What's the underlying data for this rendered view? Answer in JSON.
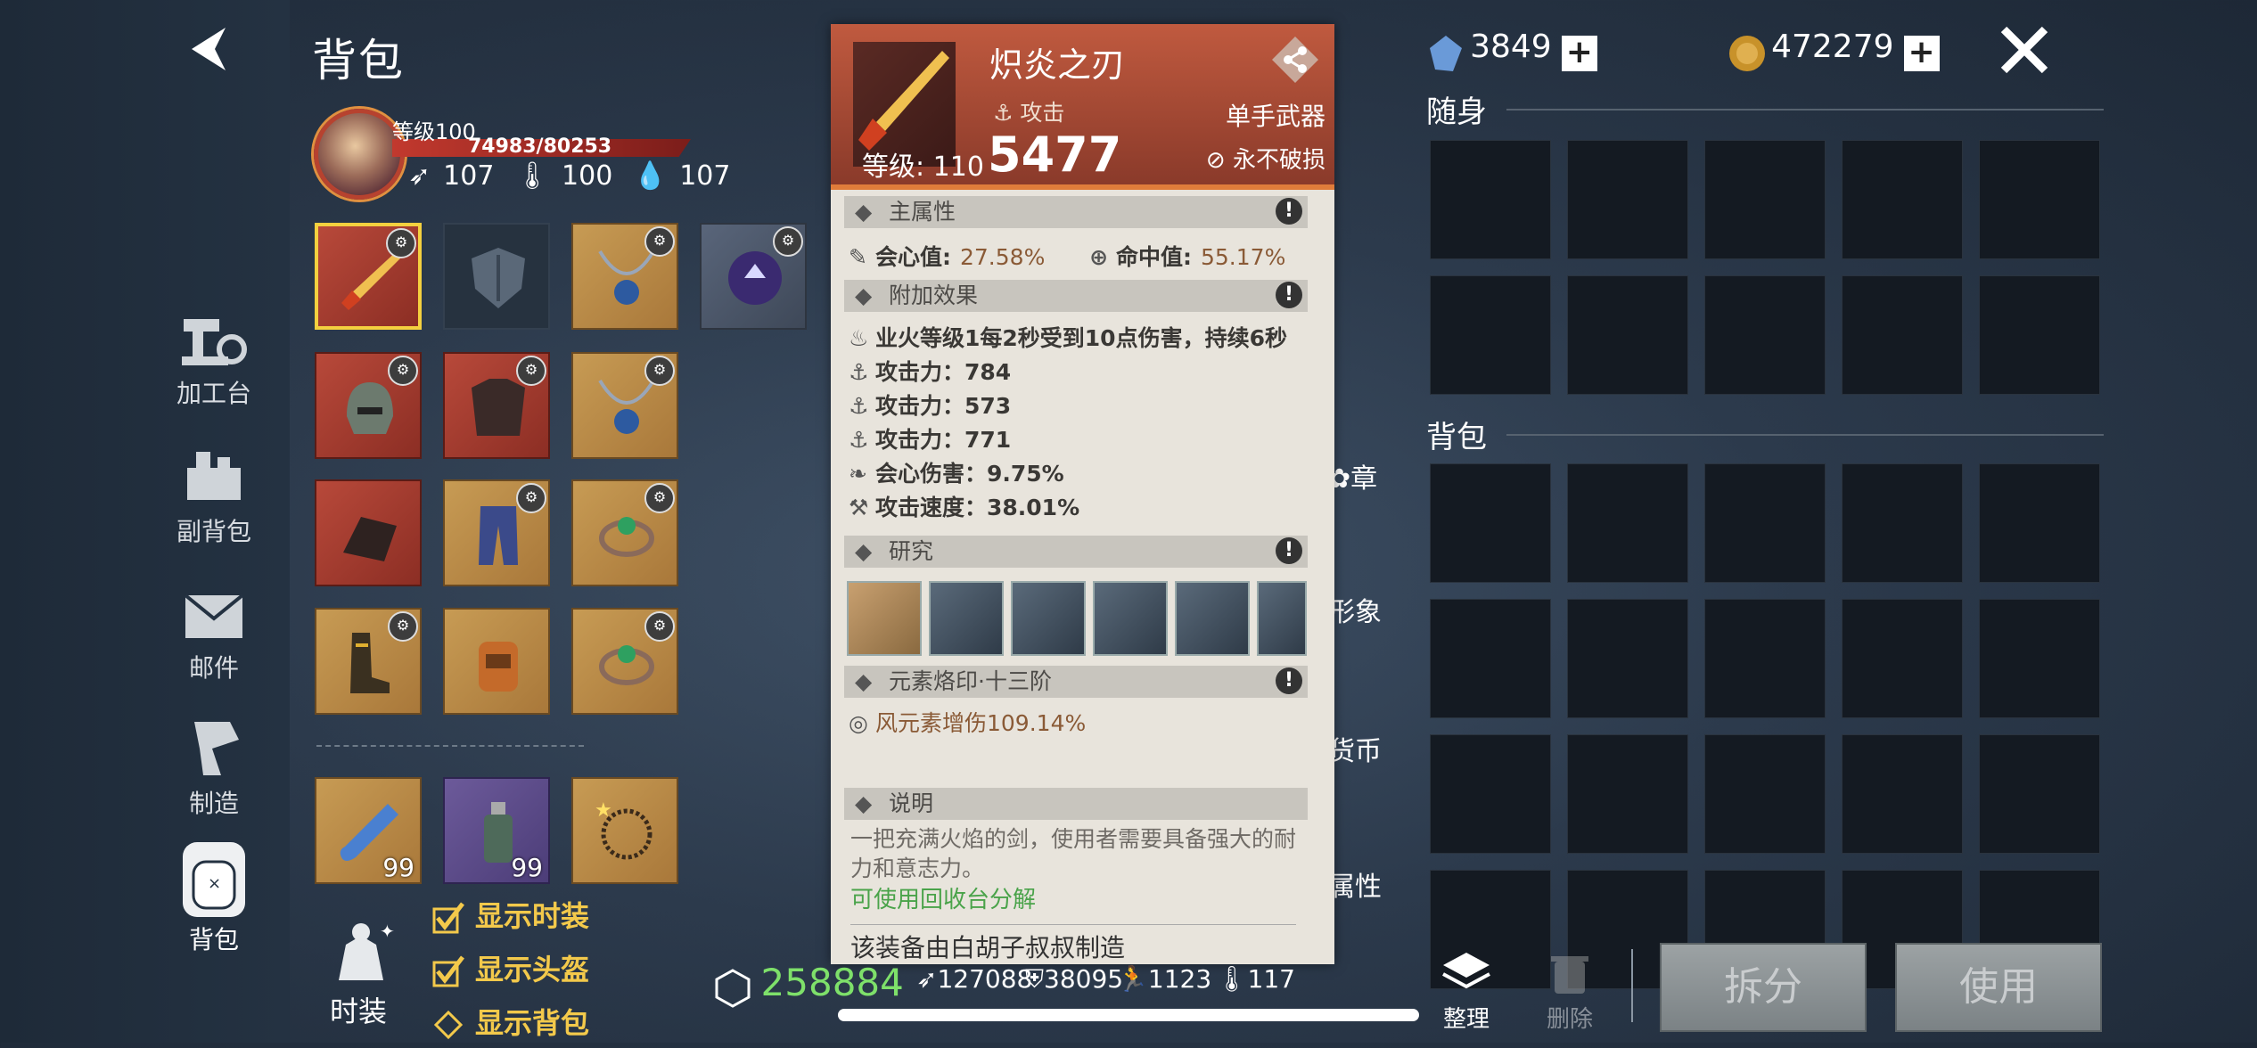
{
  "nav": {
    "items": [
      {
        "label": "加工台",
        "icon": "workbench-icon"
      },
      {
        "label": "副背包",
        "icon": "sub-backpack-icon"
      },
      {
        "label": "邮件",
        "icon": "mail-icon"
      },
      {
        "label": "制造",
        "icon": "crafting-icon"
      },
      {
        "label": "背包",
        "icon": "backpack-icon",
        "active": true
      }
    ]
  },
  "header": {
    "title": "背包"
  },
  "character": {
    "level": "等级100",
    "hp": "74983/80253",
    "stat1": "107",
    "stat2": "100",
    "stat3": "107"
  },
  "equipment": {
    "slots": [
      {
        "icon": "flame-sword-icon",
        "rarity": "red",
        "selected": true
      },
      {
        "icon": "shield-placeholder-icon",
        "rarity": "empty"
      },
      {
        "icon": "necklace-icon",
        "rarity": "gold"
      },
      {
        "icon": "purple-orb-icon",
        "rarity": "grey"
      },
      {
        "icon": "helmet-icon",
        "rarity": "red"
      },
      {
        "icon": "chest-armor-icon",
        "rarity": "red"
      },
      {
        "icon": "necklace-icon",
        "rarity": "gold"
      },
      {
        "icon": "gauntlet-icon",
        "rarity": "red"
      },
      {
        "icon": "pants-icon",
        "rarity": "gold"
      },
      {
        "icon": "ring-icon",
        "rarity": "gold"
      },
      {
        "icon": "boots-icon",
        "rarity": "gold"
      },
      {
        "icon": "backpack-item-icon",
        "rarity": "gold"
      },
      {
        "icon": "ring-icon",
        "rarity": "gold"
      }
    ],
    "consumables": [
      {
        "icon": "potion-blue-icon",
        "qty": "99",
        "rarity": "gold"
      },
      {
        "icon": "potion-bottle-icon",
        "qty": "99",
        "rarity": "purple"
      },
      {
        "icon": "thorn-ring-icon",
        "qty": "",
        "rarity": "gold"
      }
    ]
  },
  "fashion": {
    "label": "时装",
    "options": [
      {
        "label": "显示时装",
        "checked": true
      },
      {
        "label": "显示头盔",
        "checked": true
      },
      {
        "label": "显示背包",
        "checked": false
      }
    ]
  },
  "tooltip": {
    "name": "炽炎之刃",
    "type": "攻击",
    "level": "等级: 110",
    "attack": "5477",
    "category": "单手武器",
    "durability": "永不破损",
    "main_title": "主属性",
    "crit_label": "会心值:",
    "crit_value": "27.58%",
    "hit_label": "命中值:",
    "hit_value": "55.17%",
    "extra_title": "附加效果",
    "effects": [
      "业火等级1每2秒受到10点伤害，持续6秒",
      "攻击力：784",
      "攻击力：573",
      "攻击力：771",
      "会心伤害：9.75%",
      "攻击速度：38.01%"
    ],
    "research_title": "研究",
    "element_title": "元素烙印·十三阶",
    "element_value": "风元素增伤109.14%",
    "desc_title": "说明",
    "desc_text": "一把充满火焰的剑，使用者需要具备强大的耐力和意志力。",
    "recycle": "可使用回收台分解",
    "maker": "该装备由白胡子叔叔制造"
  },
  "currency": {
    "gems": "3849",
    "coins": "472279"
  },
  "grids": {
    "carry_label": "随身",
    "bag_label": "背包"
  },
  "side_tabs": [
    "章",
    "形象",
    "货币",
    "属性"
  ],
  "bottom": {
    "power": "258884",
    "stat_a": "127088",
    "stat_b": "38095",
    "stat_c": "1123",
    "stat_d": "117",
    "sort": "整理",
    "delete": "删除",
    "split": "拆分",
    "use": "使用"
  }
}
